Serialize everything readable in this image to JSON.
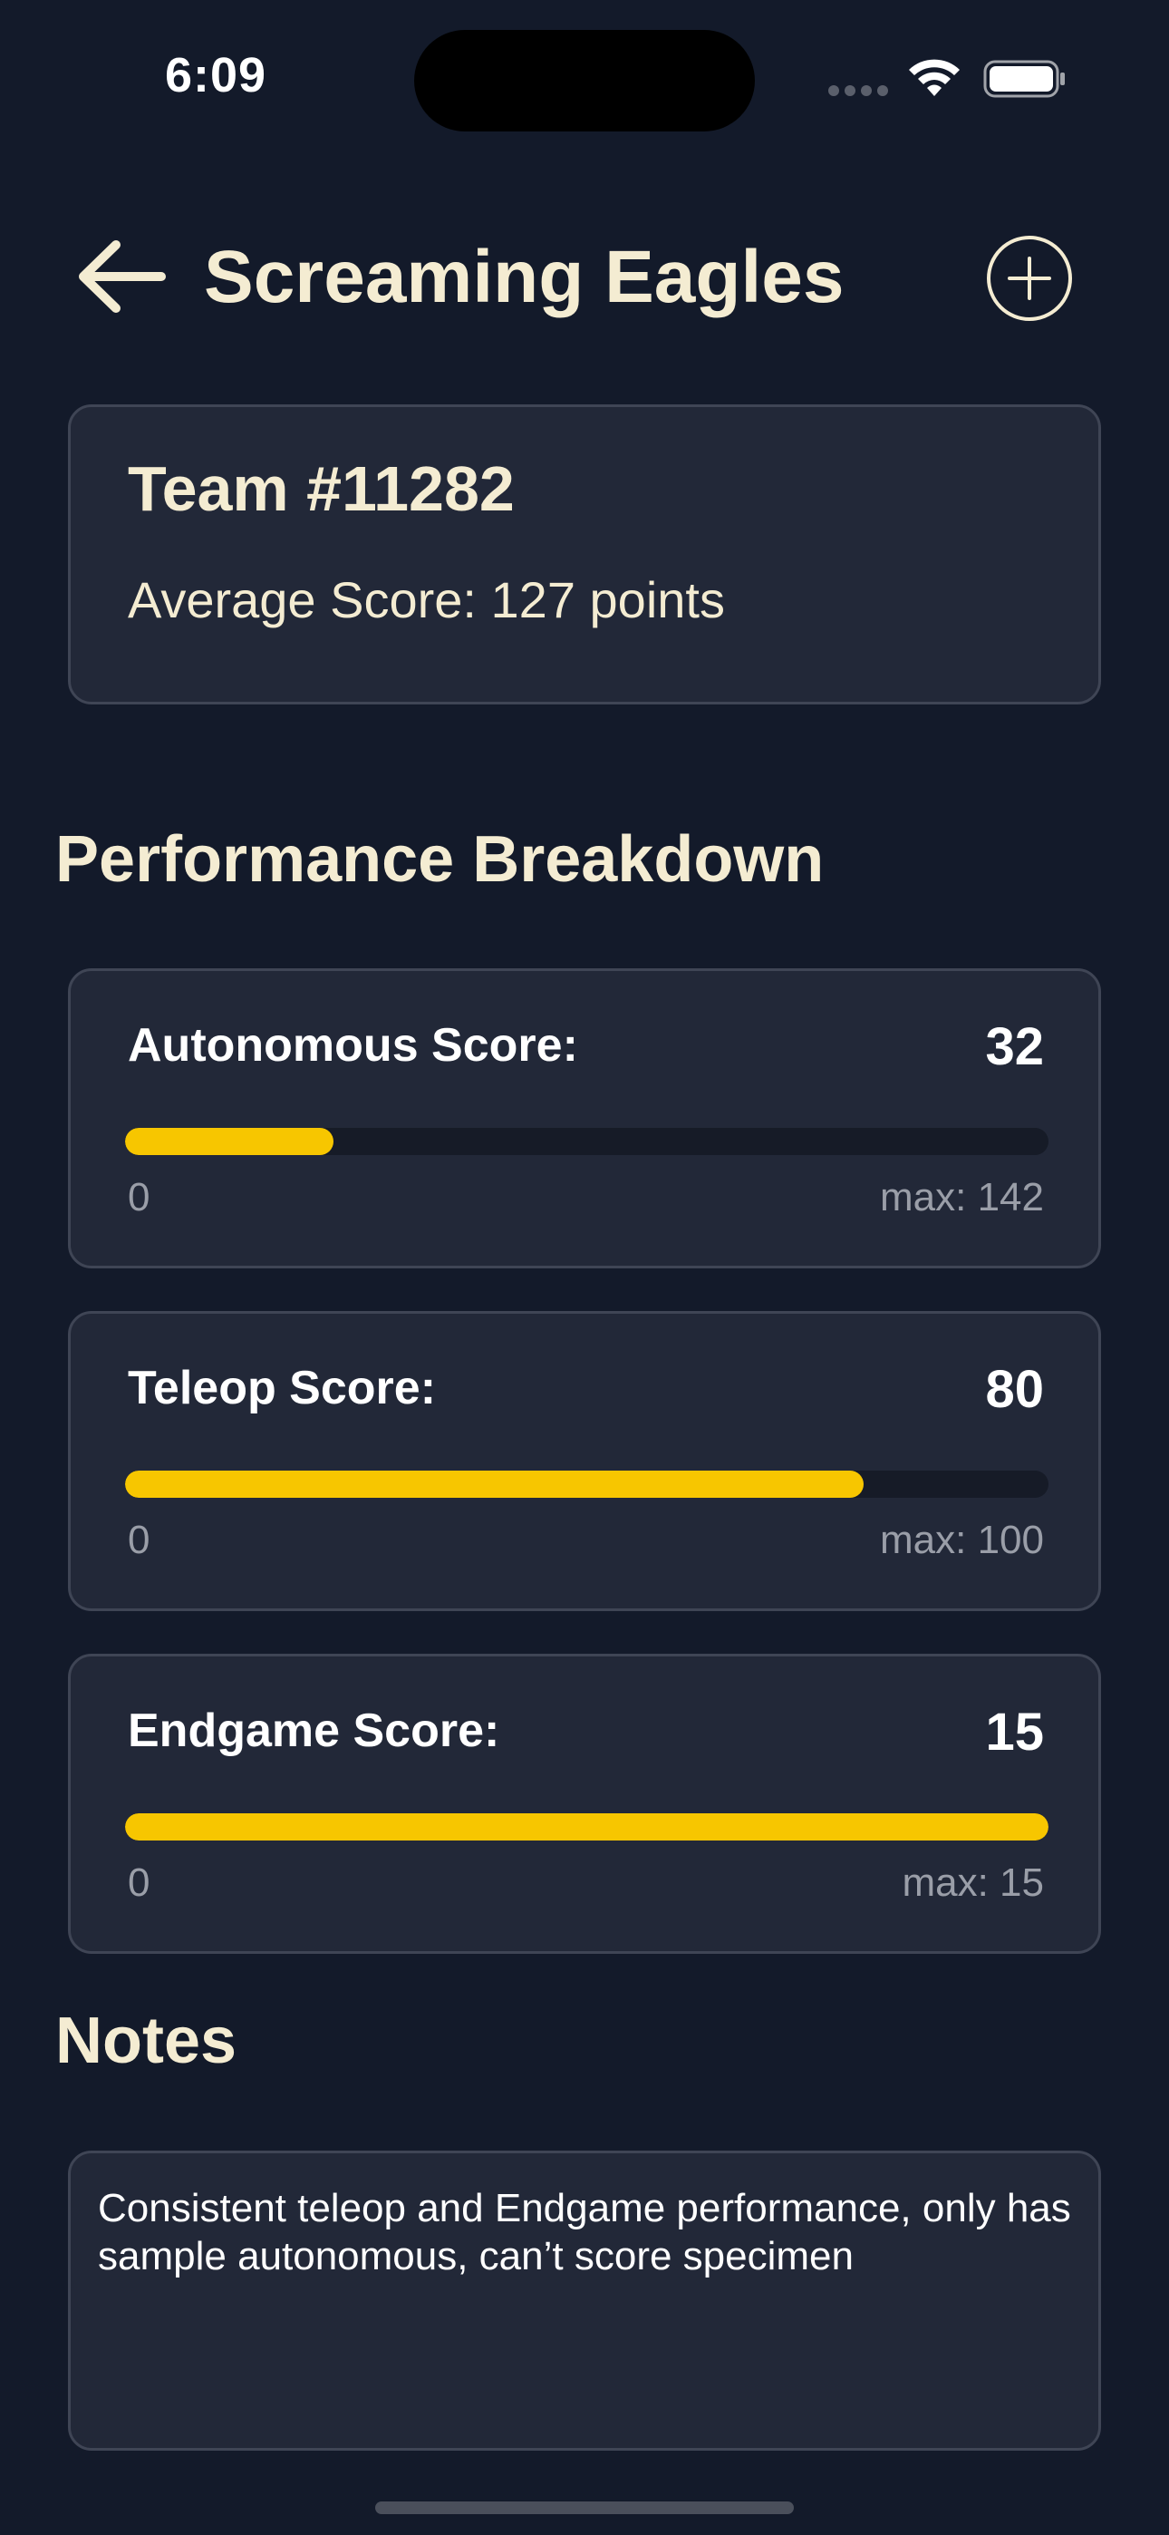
{
  "status_bar": {
    "time": "6:09",
    "icons": [
      "cellular-signal-icon",
      "wifi-icon",
      "battery-icon"
    ]
  },
  "header": {
    "title": "Screaming Eagles",
    "back_icon": "arrow-left-icon",
    "add_icon": "plus-circle-icon"
  },
  "team_card": {
    "team_number": "Team #11282",
    "average_score": "Average Score: 127 points"
  },
  "breakdown": {
    "title": "Performance Breakdown",
    "items": [
      {
        "label": "Autonomous Score:",
        "value": "32",
        "min": "0",
        "max": "max: 142",
        "fill_fraction": 0.2254
      },
      {
        "label": "Teleop Score:",
        "value": "80",
        "min": "0",
        "max": "max: 100",
        "fill_fraction": 0.8
      },
      {
        "label": "Endgame Score:",
        "value": "15",
        "min": "0",
        "max": "max: 15",
        "fill_fraction": 1.0
      }
    ]
  },
  "notes": {
    "title": "Notes",
    "text": "Consistent teleop and Endgame performance, only has sample autonomous, can’t score specimen"
  },
  "colors": {
    "background": "#131a2a",
    "card": "#222838",
    "card_border": "#3f4555",
    "accent": "#f7c600",
    "title_text": "#f4ecd2"
  }
}
